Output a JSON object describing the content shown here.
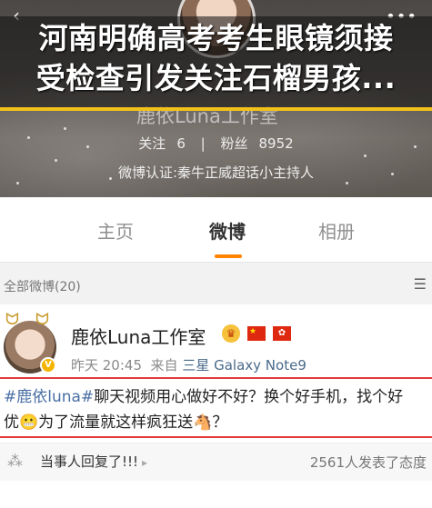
{
  "overlay": {
    "line1": "河南明确高考考生眼镜须接",
    "line2": "受检查引发关注石榴男孩..."
  },
  "profile": {
    "name": "鹿依Luna工作室",
    "following_label": "关注",
    "following_count": "6",
    "separator": "|",
    "followers_label": "粉丝",
    "followers_count": "8952",
    "verification": "微博认证:秦牛正威超话小主持人"
  },
  "tabs": [
    {
      "label": "主页"
    },
    {
      "label": "微博"
    },
    {
      "label": "相册"
    }
  ],
  "filter": {
    "label": "全部微博(20)"
  },
  "post": {
    "author": "鹿依Luna工作室",
    "time": "昨天 20:45",
    "source_prefix": "来自",
    "device": "三星 Galaxy Note9",
    "topic": "#鹿依luna#",
    "text_line1": "聊天视频用心做好不好？换个好手机，找个好",
    "text_line2_a": "优",
    "text_line2_b": "为了流量就这样疯狂送",
    "text_line2_c": "？",
    "comment_label": "当事人回复了!!!",
    "comment_stats": "2561人发表了态度"
  },
  "colors": {
    "accent": "#ff8200",
    "highlight_border": "#e23a3a",
    "headline_underline": "#f2c21a",
    "topic_link": "#4a6fa5"
  }
}
